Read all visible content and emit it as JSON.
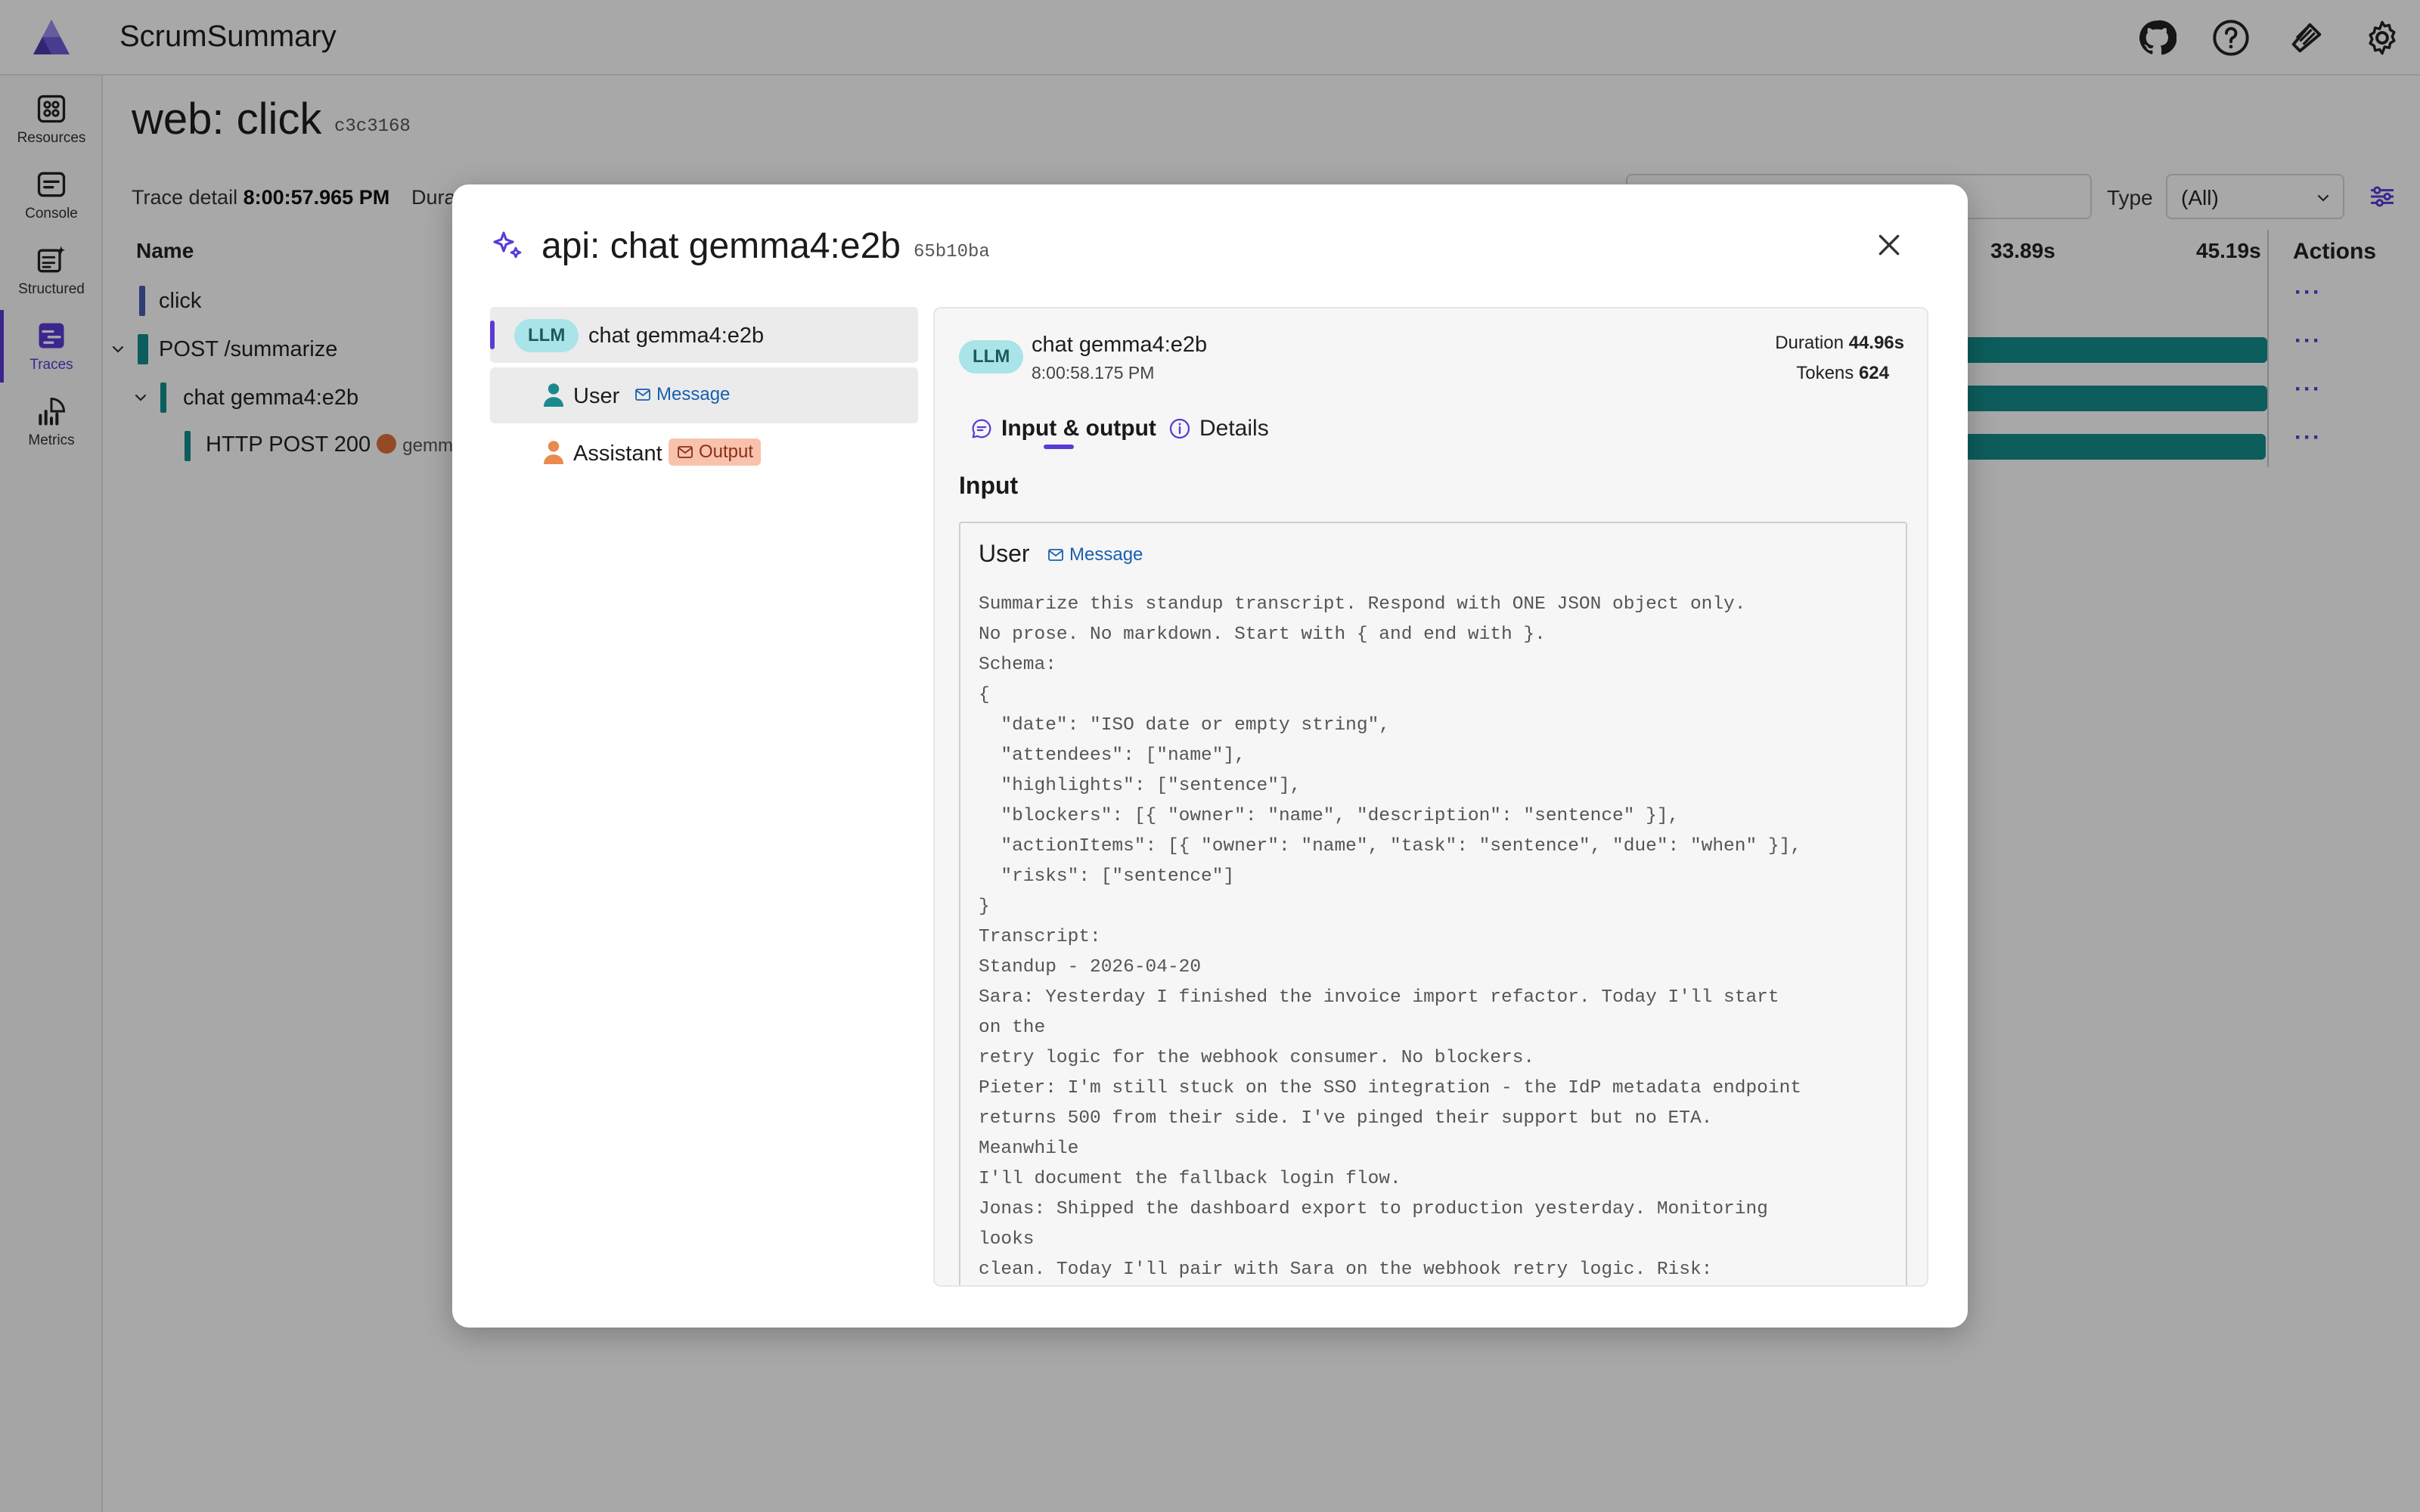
{
  "app": {
    "title": "ScrumSummary",
    "sidebar": [
      {
        "label": "Resources",
        "icon": "resources-icon"
      },
      {
        "label": "Console",
        "icon": "console-icon"
      },
      {
        "label": "Structured",
        "icon": "structured-icon"
      },
      {
        "label": "Traces",
        "icon": "traces-icon",
        "active": true
      },
      {
        "label": "Metrics",
        "icon": "metrics-icon"
      }
    ],
    "page_title": "web: click",
    "page_id": "c3c3168",
    "trace_detail_label": "Trace detail",
    "trace_detail_time": "8:00:57.965 PM",
    "duration_label": "Dura",
    "type_label": "Type",
    "type_value": "(All)",
    "columns": {
      "name": "Name",
      "t1": "33.89s",
      "t2": "45.19s",
      "actions": "Actions"
    },
    "rows": [
      {
        "label": "click"
      },
      {
        "label": "POST /summarize"
      },
      {
        "label": "chat gemma4:e2b"
      },
      {
        "label": "HTTP POST 200",
        "suffix": "gemma"
      }
    ],
    "accent": "#5b3bd6",
    "bar_color": "#158d8d"
  },
  "modal": {
    "title": "api: chat gemma4:e2b",
    "id": "65b10ba",
    "tree": [
      {
        "badge": "LLM",
        "label": "chat gemma4:e2b"
      },
      {
        "label": "User",
        "chip": "Message"
      },
      {
        "label": "Assistant",
        "chip": "Output"
      }
    ],
    "panel": {
      "badge": "LLM",
      "name": "chat gemma4:e2b",
      "time": "8:00:58.175 PM",
      "duration_label": "Duration",
      "duration_value": "44.96s",
      "tokens_label": "Tokens",
      "tokens_value": "624",
      "tabs": [
        "Input & output",
        "Details"
      ],
      "input_heading": "Input",
      "message_role": "User",
      "message_chip": "Message",
      "message_text": "Summarize this standup transcript. Respond with ONE JSON object only.\nNo prose. No markdown. Start with { and end with }.\nSchema:\n{\n  \"date\": \"ISO date or empty string\",\n  \"attendees\": [\"name\"],\n  \"highlights\": [\"sentence\"],\n  \"blockers\": [{ \"owner\": \"name\", \"description\": \"sentence\" }],\n  \"actionItems\": [{ \"owner\": \"name\", \"task\": \"sentence\", \"due\": \"when\" }],\n  \"risks\": [\"sentence\"]\n}\nTranscript:\nStandup - 2026-04-20\nSara: Yesterday I finished the invoice import refactor. Today I'll start\non the\nretry logic for the webhook consumer. No blockers.\nPieter: I'm still stuck on the SSO integration - the IdP metadata endpoint\nreturns 500 from their side. I've pinged their support but no ETA.\nMeanwhile\nI'll document the fallback login flow.\nJonas: Shipped the dashboard export to production yesterday. Monitoring\nlooks\nclean. Today I'll pair with Sara on the webhook retry logic. Risk:"
    }
  }
}
